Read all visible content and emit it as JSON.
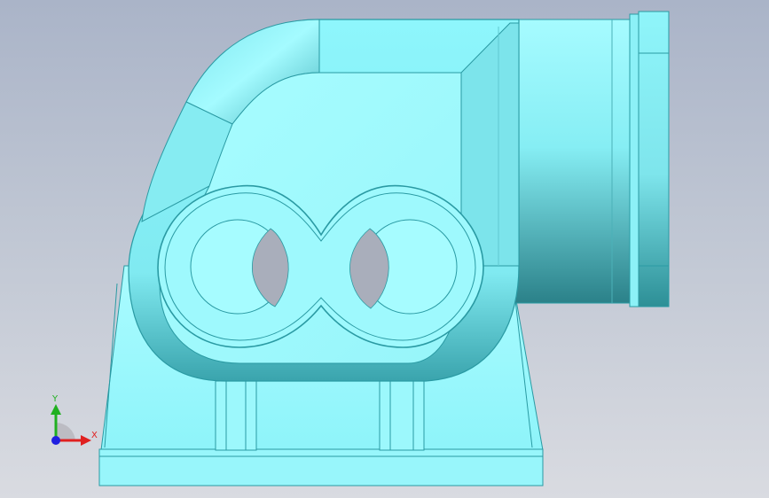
{
  "viewport": {
    "background_top": "#aab4c8",
    "background_bottom": "#d9dbe1",
    "model_color": "#8ff6fb",
    "edge_color": "#2a9aa3"
  },
  "triad": {
    "x_label": "X",
    "y_label": "Y",
    "x_color": "#e02020",
    "y_color": "#20b020",
    "z_color": "#2020e0"
  }
}
